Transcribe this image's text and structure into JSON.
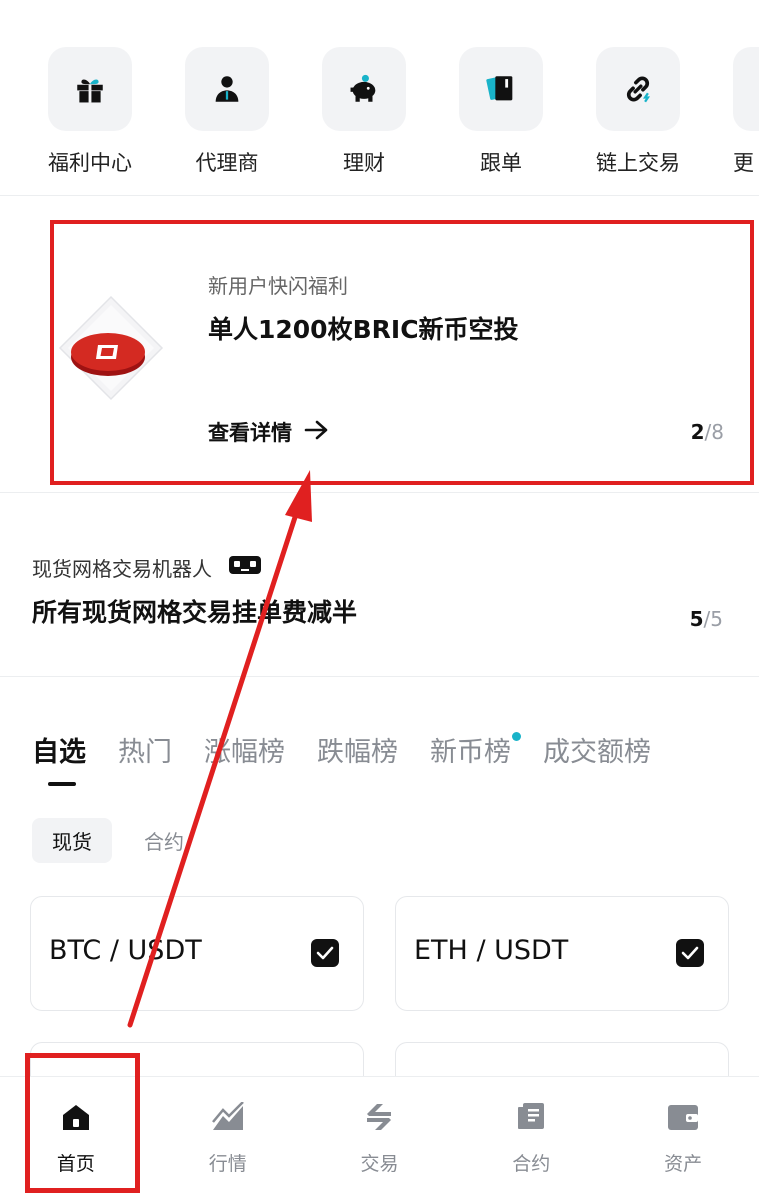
{
  "shortcuts": [
    {
      "label": "福利中心",
      "icon": "gift-icon"
    },
    {
      "label": "代理商",
      "icon": "agent-icon"
    },
    {
      "label": "理财",
      "icon": "piggy-bank-icon"
    },
    {
      "label": "跟单",
      "icon": "copy-trade-icon"
    },
    {
      "label": "链上交易",
      "icon": "chain-link-icon"
    },
    {
      "label": "更",
      "icon": "more-icon"
    }
  ],
  "promo": {
    "subtitle": "新用户快闪福利",
    "title": "单人1200枚BRIC新币空投",
    "detail_label": "查看详情",
    "pager_current": "2",
    "pager_total": "/8"
  },
  "grid_note": {
    "subtitle": "现货网格交易机器人",
    "title": "所有现货网格交易挂单费减半",
    "pager_current": "5",
    "pager_total": "/5"
  },
  "market_tabs": [
    "自选",
    "热门",
    "涨幅榜",
    "跌幅榜",
    "新币榜",
    "成交额榜"
  ],
  "market_type": [
    "现货",
    "合约"
  ],
  "pairs": [
    "BTC / USDT",
    "ETH / USDT"
  ],
  "bottom_nav": [
    {
      "label": "首页",
      "icon": "home-icon"
    },
    {
      "label": "行情",
      "icon": "chart-icon"
    },
    {
      "label": "交易",
      "icon": "exchange-icon"
    },
    {
      "label": "合约",
      "icon": "contract-icon"
    },
    {
      "label": "资产",
      "icon": "wallet-icon"
    }
  ],
  "colors": {
    "annotation": "#e02020",
    "accent_dot": "#19b3c9",
    "text": "#111111",
    "muted": "#888c93"
  }
}
